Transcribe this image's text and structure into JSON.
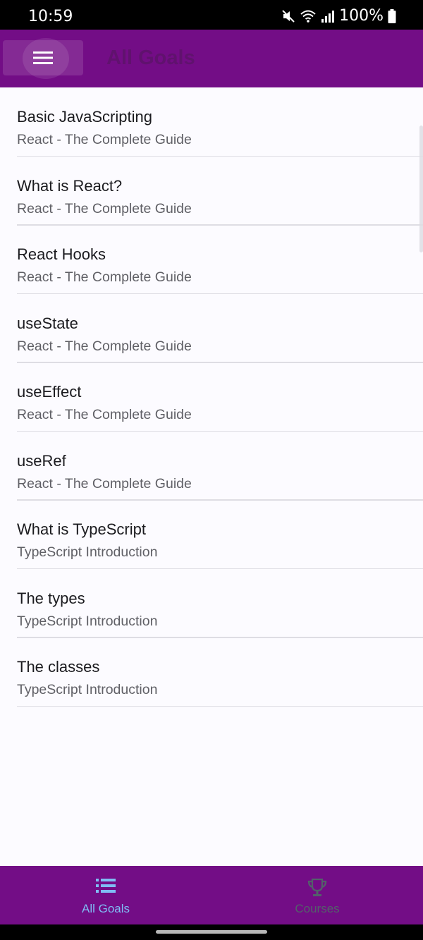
{
  "status": {
    "time": "10:59",
    "battery": "100%"
  },
  "header": {
    "title": "All Goals"
  },
  "goals": [
    {
      "title": "Basic JavaScripting",
      "course": "React - The Complete Guide"
    },
    {
      "title": "What is React?",
      "course": "React - The Complete Guide"
    },
    {
      "title": "React Hooks",
      "course": "React - The Complete Guide"
    },
    {
      "title": "useState",
      "course": "React - The Complete Guide"
    },
    {
      "title": "useEffect",
      "course": "React - The Complete Guide"
    },
    {
      "title": "useRef",
      "course": "React - The Complete Guide"
    },
    {
      "title": "What is TypeScript",
      "course": "TypeScript Introduction"
    },
    {
      "title": "The types",
      "course": "TypeScript Introduction"
    },
    {
      "title": "The classes",
      "course": "TypeScript Introduction"
    }
  ],
  "nav": {
    "items": [
      {
        "label": "All Goals",
        "icon": "list-icon",
        "active": true
      },
      {
        "label": "Courses",
        "icon": "trophy-icon",
        "active": false
      }
    ]
  },
  "colors": {
    "primary": "#730d86",
    "active_tab": "#7fbcf4",
    "inactive_tab": "#53606a"
  }
}
